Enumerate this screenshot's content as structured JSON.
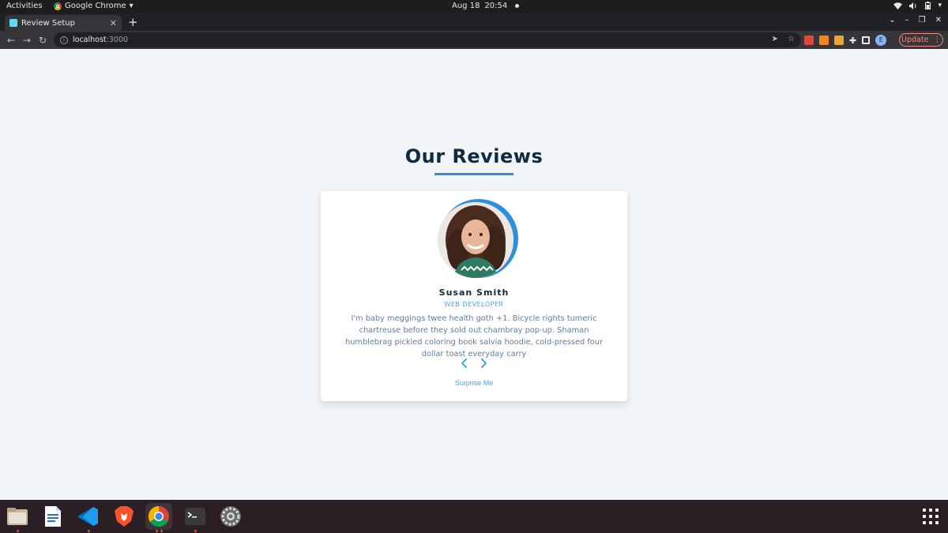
{
  "system": {
    "activities": "Activities",
    "app_name": "Google Chrome",
    "date": "Aug 18",
    "time": "20:54"
  },
  "browser": {
    "tab_title": "Review Setup",
    "url_host": "localhost",
    "url_port": ":3000",
    "update_label": "Update",
    "profile_initial": "E"
  },
  "page": {
    "heading": "Our Reviews",
    "review": {
      "name": "Susan Smith",
      "job": "WEB DEVELOPER",
      "text": "I'm baby meggings twee health goth +1. Bicycle rights tumeric chartreuse before they sold out chambray pop-up. Shaman humblebrag pickled coloring book salvia hoodie, cold-pressed four dollar toast everyday carry"
    },
    "prev_symbol": "‹",
    "next_symbol": "›",
    "random_label": "Surprise Me"
  },
  "colors": {
    "accent": "#2f8fdc",
    "heading": "#102a42",
    "body_text": "#617d98",
    "background": "#f1f5f8"
  },
  "dock": {
    "items": [
      "files-icon",
      "text-editor-icon",
      "vscode-icon",
      "brave-icon",
      "chrome-icon",
      "terminal-icon",
      "settings-icon"
    ]
  }
}
